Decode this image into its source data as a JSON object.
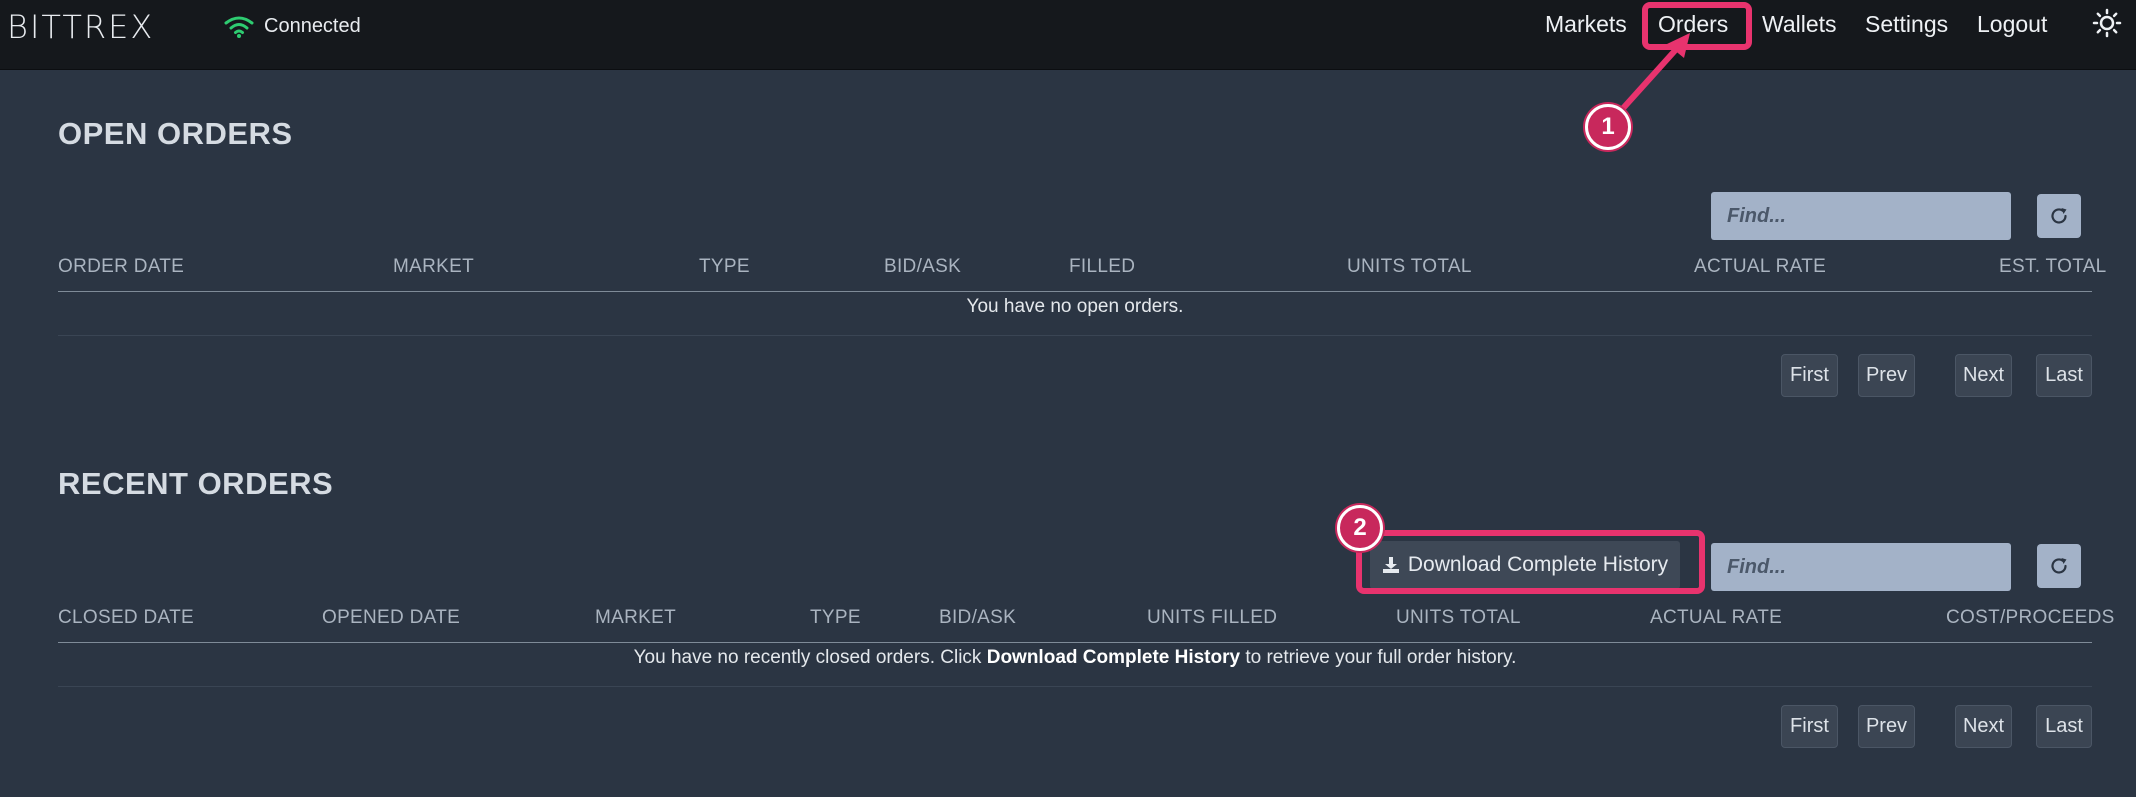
{
  "header": {
    "brand": "BITTREX",
    "connection_status": "Connected",
    "nav": {
      "markets": "Markets",
      "orders": "Orders",
      "wallets": "Wallets",
      "settings": "Settings",
      "logout": "Logout"
    },
    "theme_icon": "sun-icon"
  },
  "open_orders": {
    "title": "OPEN ORDERS",
    "search_placeholder": "Find...",
    "columns": [
      "ORDER DATE",
      "MARKET",
      "TYPE",
      "BID/ASK",
      "FILLED",
      "UNITS TOTAL",
      "ACTUAL RATE",
      "EST. TOTAL"
    ],
    "empty_message": "You have no open orders.",
    "pagination": {
      "first": "First",
      "prev": "Prev",
      "next": "Next",
      "last": "Last"
    }
  },
  "recent_orders": {
    "title": "RECENT ORDERS",
    "download_label": "Download Complete History",
    "search_placeholder": "Find...",
    "columns": [
      "CLOSED DATE",
      "OPENED DATE",
      "MARKET",
      "TYPE",
      "BID/ASK",
      "UNITS FILLED",
      "UNITS TOTAL",
      "ACTUAL RATE",
      "COST/PROCEEDS"
    ],
    "empty_message_pre": "You have no recently closed orders. Click ",
    "empty_message_bold": "Download Complete History",
    "empty_message_post": " to retrieve your full order history.",
    "pagination": {
      "first": "First",
      "prev": "Prev",
      "next": "Next",
      "last": "Last"
    }
  },
  "annotations": {
    "step1": "1",
    "step2": "2",
    "highlight_color": "#e8336e"
  },
  "colors": {
    "background": "#2b3543",
    "topbar": "#15181c",
    "connected_green": "#2ecc71",
    "input_bg": "#a3b2c8"
  }
}
